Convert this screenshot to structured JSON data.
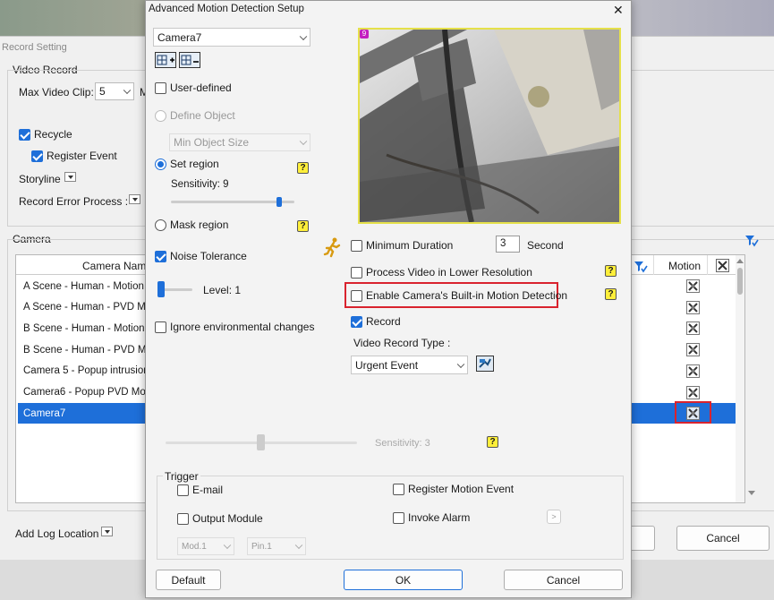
{
  "background_window": {
    "title": "Record Setting",
    "video_record": {
      "group_label": "Video Record",
      "max_video_clip_label": "Max Video Clip:",
      "max_video_clip_value": "5",
      "max_video_clip_suffix": "M",
      "recycle_label": "Recycle",
      "register_event_label": "Register Event",
      "storyline_label": "Storyline",
      "record_error_process_label": "Record Error Process :"
    },
    "camera": {
      "group_label": "Camera",
      "col_camera_name": "Camera Nam",
      "col_motion": "Motion",
      "rows": [
        "A Scene - Human - Motion",
        "A Scene - Human - PVD Mo",
        "B Scene - Human - Motion",
        "B Scene - Human - PVD Mo",
        "Camera 5 - Popup intrusion",
        "Camera6 - Popup PVD Moti",
        "Camera7"
      ],
      "selected_index": 6
    },
    "add_log_location_label": "Add Log Location",
    "cancel_label": "Cancel"
  },
  "dialog": {
    "title": "Advanced Motion Detection Setup",
    "camera_select": "Camera7",
    "user_defined_label": "User-defined",
    "define_object_label": "Define Object",
    "min_object_size_label": "Min Object Size",
    "set_region_label": "Set region",
    "sensitivity_label": "Sensitivity: 9",
    "sensitivity_level": 9,
    "mask_region_label": "Mask region",
    "noise_tolerance_label": "Noise Tolerance",
    "noise_level_label": "Level: 1",
    "ignore_env_label": "Ignore environmental changes",
    "minimum_duration_label": "Minimum Duration",
    "minimum_duration_value": "3",
    "second_label": "Second",
    "process_lower_res_label": "Process Video in Lower Resolution",
    "enable_builtin_label": "Enable Camera's Built-in Motion Detection",
    "record_label": "Record",
    "video_record_type_label": "Video Record Type :",
    "video_record_type_value": "Urgent Event",
    "bottom_sensitivity_label": "Sensitivity: 3",
    "preview_badge": "9",
    "help_glyph": "?",
    "trigger": {
      "group_label": "Trigger",
      "email_label": "E-mail",
      "output_module_label": "Output Module",
      "register_motion_event_label": "Register Motion Event",
      "invoke_alarm_label": "Invoke Alarm",
      "mod_select": "Mod.1",
      "pin_select": "Pin.1",
      "more_label": ">"
    },
    "default_label": "Default",
    "ok_label": "OK",
    "cancel_label": "Cancel",
    "close_glyph": "✕"
  },
  "colors": {
    "accent": "#1e6fd9",
    "highlight_border": "#d9232e",
    "help_yellow": "#ffef3a",
    "preview_border": "#e5e04a"
  }
}
